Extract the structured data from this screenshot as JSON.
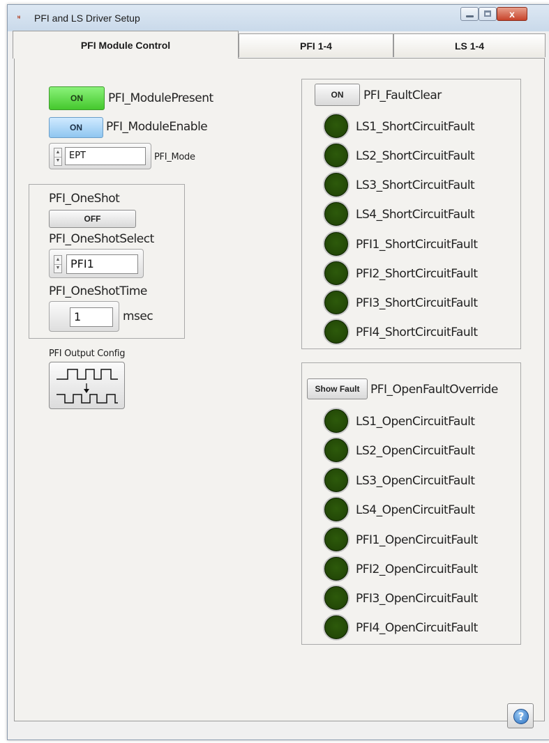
{
  "window": {
    "title": "PFI and LS Driver Setup",
    "close_glyph": "x"
  },
  "tabs": [
    {
      "label": "PFI Module Control",
      "active": true
    },
    {
      "label": "PFI 1-4",
      "active": false
    },
    {
      "label": "LS 1-4",
      "active": false
    }
  ],
  "module": {
    "present": {
      "button": "ON",
      "label": "PFI_ModulePresent"
    },
    "enable": {
      "button": "ON",
      "label": "PFI_ModuleEnable"
    },
    "mode": {
      "value": "EPT",
      "label": "PFI_Mode"
    }
  },
  "oneshot": {
    "label": "PFI_OneShot",
    "button": "OFF",
    "select_label": "PFI_OneShotSelect",
    "select_value": "PFI1",
    "time_label": "PFI_OneShotTime",
    "time_value": "1",
    "time_unit": "msec"
  },
  "output_config": {
    "label": "PFI Output Config"
  },
  "short_faults": {
    "clear_button": "ON",
    "clear_label": "PFI_FaultClear",
    "items": [
      "LS1_ShortCircuitFault",
      "LS2_ShortCircuitFault",
      "LS3_ShortCircuitFault",
      "LS4_ShortCircuitFault",
      "PFI1_ShortCircuitFault",
      "PFI2_ShortCircuitFault",
      "PFI3_ShortCircuitFault",
      "PFI4_ShortCircuitFault"
    ]
  },
  "open_faults": {
    "override_button": "Show Fault",
    "override_label": "PFI_OpenFaultOverride",
    "items": [
      "LS1_OpenCircuitFault",
      "LS2_OpenCircuitFault",
      "LS3_OpenCircuitFault",
      "LS4_OpenCircuitFault",
      "PFI1_OpenCircuitFault",
      "PFI2_OpenCircuitFault",
      "PFI3_OpenCircuitFault",
      "PFI4_OpenCircuitFault"
    ]
  },
  "help": {
    "glyph": "?"
  },
  "colors": {
    "led_off": "#244a07",
    "on_green": "#45c82d",
    "on_blue": "#8fc6f0"
  }
}
